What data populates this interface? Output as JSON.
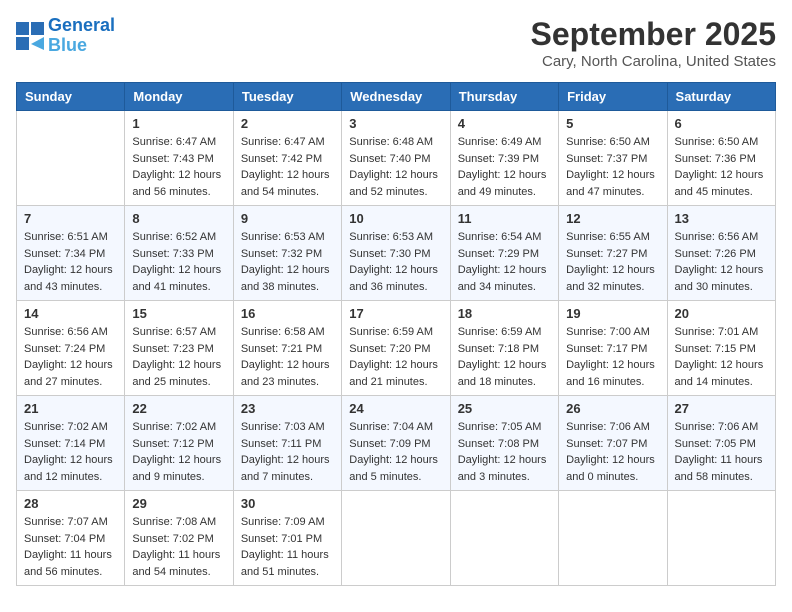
{
  "header": {
    "logo_line1": "General",
    "logo_line2": "Blue",
    "month": "September 2025",
    "location": "Cary, North Carolina, United States"
  },
  "days_of_week": [
    "Sunday",
    "Monday",
    "Tuesday",
    "Wednesday",
    "Thursday",
    "Friday",
    "Saturday"
  ],
  "weeks": [
    [
      {
        "day": "",
        "info": ""
      },
      {
        "day": "1",
        "info": "Sunrise: 6:47 AM\nSunset: 7:43 PM\nDaylight: 12 hours and 56 minutes."
      },
      {
        "day": "2",
        "info": "Sunrise: 6:47 AM\nSunset: 7:42 PM\nDaylight: 12 hours and 54 minutes."
      },
      {
        "day": "3",
        "info": "Sunrise: 6:48 AM\nSunset: 7:40 PM\nDaylight: 12 hours and 52 minutes."
      },
      {
        "day": "4",
        "info": "Sunrise: 6:49 AM\nSunset: 7:39 PM\nDaylight: 12 hours and 49 minutes."
      },
      {
        "day": "5",
        "info": "Sunrise: 6:50 AM\nSunset: 7:37 PM\nDaylight: 12 hours and 47 minutes."
      },
      {
        "day": "6",
        "info": "Sunrise: 6:50 AM\nSunset: 7:36 PM\nDaylight: 12 hours and 45 minutes."
      }
    ],
    [
      {
        "day": "7",
        "info": "Sunrise: 6:51 AM\nSunset: 7:34 PM\nDaylight: 12 hours and 43 minutes."
      },
      {
        "day": "8",
        "info": "Sunrise: 6:52 AM\nSunset: 7:33 PM\nDaylight: 12 hours and 41 minutes."
      },
      {
        "day": "9",
        "info": "Sunrise: 6:53 AM\nSunset: 7:32 PM\nDaylight: 12 hours and 38 minutes."
      },
      {
        "day": "10",
        "info": "Sunrise: 6:53 AM\nSunset: 7:30 PM\nDaylight: 12 hours and 36 minutes."
      },
      {
        "day": "11",
        "info": "Sunrise: 6:54 AM\nSunset: 7:29 PM\nDaylight: 12 hours and 34 minutes."
      },
      {
        "day": "12",
        "info": "Sunrise: 6:55 AM\nSunset: 7:27 PM\nDaylight: 12 hours and 32 minutes."
      },
      {
        "day": "13",
        "info": "Sunrise: 6:56 AM\nSunset: 7:26 PM\nDaylight: 12 hours and 30 minutes."
      }
    ],
    [
      {
        "day": "14",
        "info": "Sunrise: 6:56 AM\nSunset: 7:24 PM\nDaylight: 12 hours and 27 minutes."
      },
      {
        "day": "15",
        "info": "Sunrise: 6:57 AM\nSunset: 7:23 PM\nDaylight: 12 hours and 25 minutes."
      },
      {
        "day": "16",
        "info": "Sunrise: 6:58 AM\nSunset: 7:21 PM\nDaylight: 12 hours and 23 minutes."
      },
      {
        "day": "17",
        "info": "Sunrise: 6:59 AM\nSunset: 7:20 PM\nDaylight: 12 hours and 21 minutes."
      },
      {
        "day": "18",
        "info": "Sunrise: 6:59 AM\nSunset: 7:18 PM\nDaylight: 12 hours and 18 minutes."
      },
      {
        "day": "19",
        "info": "Sunrise: 7:00 AM\nSunset: 7:17 PM\nDaylight: 12 hours and 16 minutes."
      },
      {
        "day": "20",
        "info": "Sunrise: 7:01 AM\nSunset: 7:15 PM\nDaylight: 12 hours and 14 minutes."
      }
    ],
    [
      {
        "day": "21",
        "info": "Sunrise: 7:02 AM\nSunset: 7:14 PM\nDaylight: 12 hours and 12 minutes."
      },
      {
        "day": "22",
        "info": "Sunrise: 7:02 AM\nSunset: 7:12 PM\nDaylight: 12 hours and 9 minutes."
      },
      {
        "day": "23",
        "info": "Sunrise: 7:03 AM\nSunset: 7:11 PM\nDaylight: 12 hours and 7 minutes."
      },
      {
        "day": "24",
        "info": "Sunrise: 7:04 AM\nSunset: 7:09 PM\nDaylight: 12 hours and 5 minutes."
      },
      {
        "day": "25",
        "info": "Sunrise: 7:05 AM\nSunset: 7:08 PM\nDaylight: 12 hours and 3 minutes."
      },
      {
        "day": "26",
        "info": "Sunrise: 7:06 AM\nSunset: 7:07 PM\nDaylight: 12 hours and 0 minutes."
      },
      {
        "day": "27",
        "info": "Sunrise: 7:06 AM\nSunset: 7:05 PM\nDaylight: 11 hours and 58 minutes."
      }
    ],
    [
      {
        "day": "28",
        "info": "Sunrise: 7:07 AM\nSunset: 7:04 PM\nDaylight: 11 hours and 56 minutes."
      },
      {
        "day": "29",
        "info": "Sunrise: 7:08 AM\nSunset: 7:02 PM\nDaylight: 11 hours and 54 minutes."
      },
      {
        "day": "30",
        "info": "Sunrise: 7:09 AM\nSunset: 7:01 PM\nDaylight: 11 hours and 51 minutes."
      },
      {
        "day": "",
        "info": ""
      },
      {
        "day": "",
        "info": ""
      },
      {
        "day": "",
        "info": ""
      },
      {
        "day": "",
        "info": ""
      }
    ]
  ]
}
